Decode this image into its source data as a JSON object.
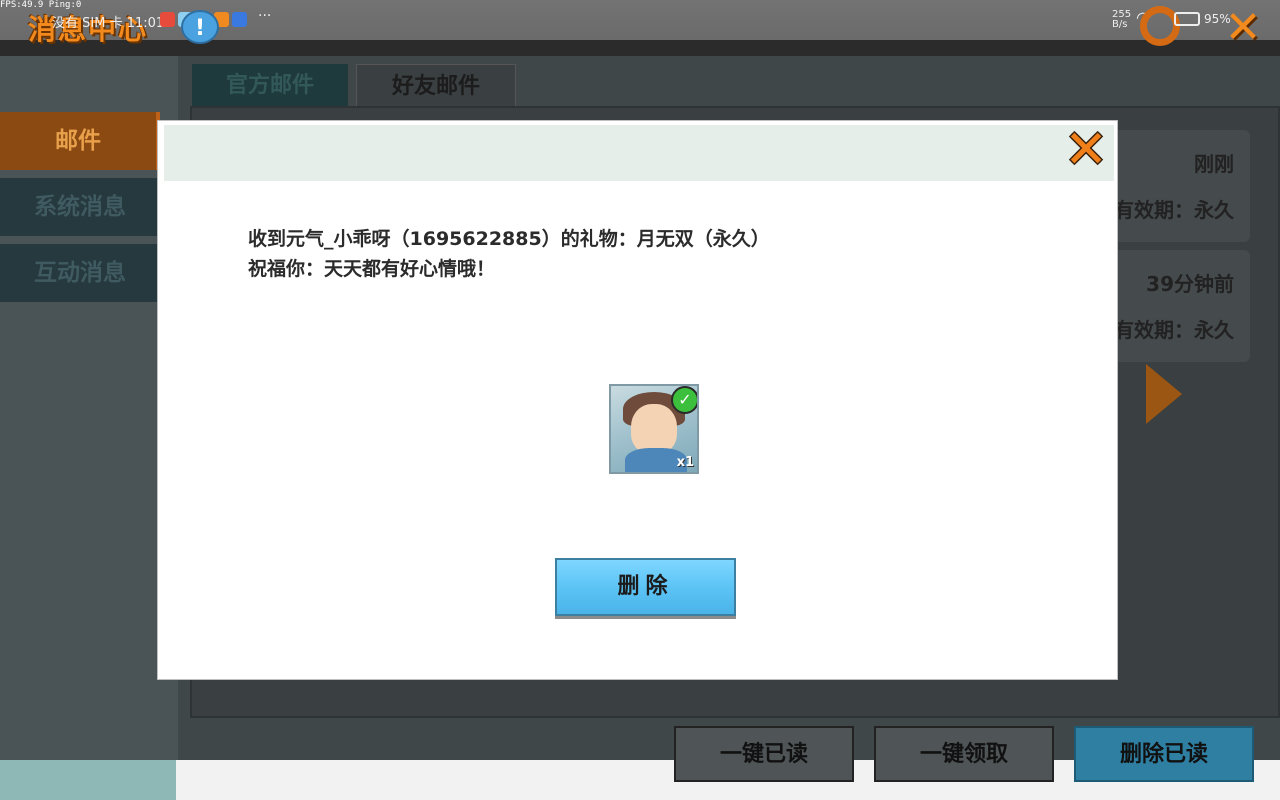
{
  "status_bar": {
    "fps": "FPS:49.9  Ping:0",
    "carrier": "没有 SIM 卡 11:01",
    "overflow": "···",
    "net_speed": "255 B/s",
    "battery": "95%"
  },
  "header": {
    "title": "消息中心",
    "bubble": "!"
  },
  "sidebar": {
    "items": [
      {
        "label": "邮件"
      },
      {
        "label": "系统消息"
      },
      {
        "label": "互动消息"
      }
    ]
  },
  "tabs": {
    "official": "官方邮件",
    "friend": "好友邮件"
  },
  "mail_list": [
    {
      "time": "刚刚",
      "expiry": "有效期：永久"
    },
    {
      "time": "39分钟前",
      "expiry": "有效期：永久"
    }
  ],
  "bottom_actions": {
    "read_all": "一键已读",
    "claim_all": "一键领取",
    "delete_read": "删除已读"
  },
  "dialog": {
    "message_line1": "收到元气_小乖呀（1695622885）的礼物：月无双（永久）",
    "message_line2": "祝福你：天天都有好心情哦！",
    "gift_count": "x1",
    "delete_label": "删除"
  },
  "colors": {
    "accent_orange": "#f28a1e",
    "button_blue": "#5cc4f5",
    "check_green": "#3cbf3c"
  }
}
